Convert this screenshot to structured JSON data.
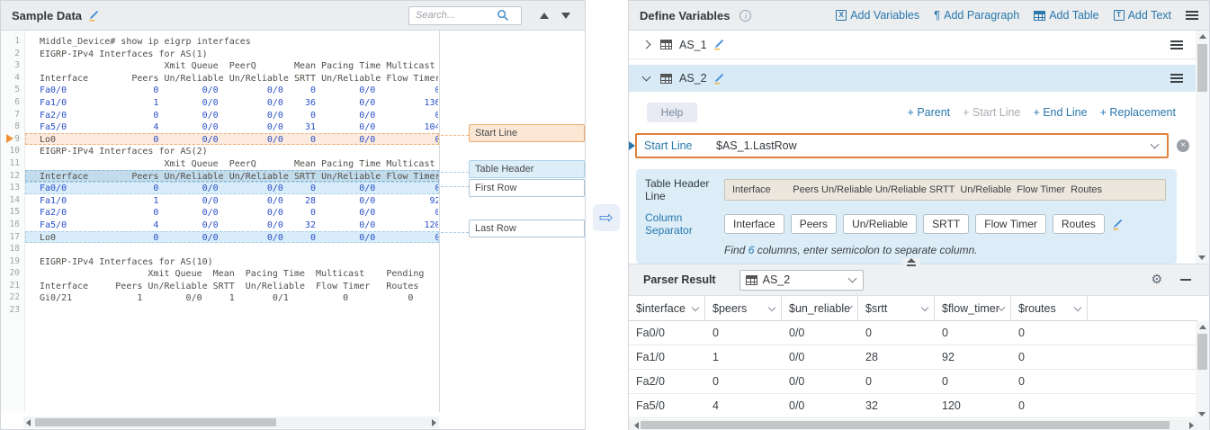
{
  "colors": {
    "accent_blue": "#2878ae",
    "code_blue": "#2b50c9",
    "start_line_orange": "#e0813c",
    "highlight_orange_bg": "#fceade",
    "highlight_blue_bg": "#d8edf9",
    "table_header_bg": "#c2dcec",
    "panel_header_bg": "#ecedef",
    "as2_header_bg": "#d7eaf6",
    "bluebox_bg": "#dcedf8"
  },
  "left_panel": {
    "title": "Sample Data",
    "search_placeholder": "Search...",
    "code_lines": [
      {
        "n": 1,
        "segs": [
          [
            "Middle_Device# show ip eigrp interfaces",
            "k"
          ]
        ]
      },
      {
        "n": 2,
        "segs": [
          [
            "EIGRP-IPv4 Interfaces for AS(1)",
            "k"
          ]
        ]
      },
      {
        "n": 3,
        "segs": [
          [
            "                       Xmit Queue  PeerQ       Mean Pacing Time Multicast",
            "k"
          ]
        ]
      },
      {
        "n": 4,
        "segs": [
          [
            "Interface        Peers Un/Reliable Un/Reliable SRTT Un/Reliable Flow Timer",
            "k"
          ]
        ]
      },
      {
        "n": 5,
        "segs": [
          [
            "Fa0/0                0        0/0         0/0     0        0/0           0",
            "b"
          ]
        ]
      },
      {
        "n": 6,
        "segs": [
          [
            "Fa1/0                1        0/0         0/0    36        0/0         136",
            "b"
          ]
        ]
      },
      {
        "n": 7,
        "segs": [
          [
            "Fa2/0                0        0/0         0/0     0        0/0           0",
            "b"
          ]
        ]
      },
      {
        "n": 8,
        "segs": [
          [
            "Fa5/0                4        0/0         0/0    31        0/0         104",
            "b"
          ]
        ]
      },
      {
        "n": 9,
        "hl": "orange",
        "segs": [
          [
            "Lo0",
            "k"
          ],
          [
            "                  0        0/0         0/0     0        0/0           0",
            "b"
          ]
        ]
      },
      {
        "n": 10,
        "segs": [
          [
            "EIGRP-IPv4 Interfaces for AS(2)",
            "k"
          ]
        ]
      },
      {
        "n": 11,
        "segs": [
          [
            "                       Xmit Queue  PeerQ       Mean Pacing Time Multicast",
            "k"
          ]
        ]
      },
      {
        "n": 12,
        "hl": "steel",
        "segs": [
          [
            "Interface        Peers Un/Reliable Un/Reliable SRTT Un/Reliable Flow Timer",
            "k"
          ]
        ]
      },
      {
        "n": 13,
        "hl": "blue",
        "segs": [
          [
            "Fa0/0                0        0/0         0/0     0        0/0           0",
            "b"
          ]
        ]
      },
      {
        "n": 14,
        "segs": [
          [
            "Fa1/0                1        0/0         0/0    28        0/0          92",
            "b"
          ]
        ]
      },
      {
        "n": 15,
        "segs": [
          [
            "Fa2/0                0        0/0         0/0     0        0/0           0",
            "b"
          ]
        ]
      },
      {
        "n": 16,
        "segs": [
          [
            "Fa5/0                4        0/0         0/0    32        0/0         120",
            "b"
          ]
        ]
      },
      {
        "n": 17,
        "hl": "blue",
        "segs": [
          [
            "Lo0",
            "k"
          ],
          [
            "                  0        0/0         0/0     0        0/0           0",
            "b"
          ]
        ]
      },
      {
        "n": 18,
        "segs": []
      },
      {
        "n": 19,
        "segs": [
          [
            "EIGRP-IPv4 Interfaces for AS(10)",
            "k"
          ]
        ]
      },
      {
        "n": 20,
        "segs": [
          [
            "                    Xmit Queue  Mean  Pacing Time  Multicast    Pending",
            "k"
          ]
        ]
      },
      {
        "n": 21,
        "segs": [
          [
            "Interface     Peers Un/Reliable SRTT  Un/Reliable  Flow Timer   Routes",
            "k"
          ]
        ]
      },
      {
        "n": 22,
        "segs": [
          [
            "Gi0/21            1        0/0     1       0/1          0           0",
            "k"
          ]
        ]
      },
      {
        "n": 23,
        "segs": []
      }
    ]
  },
  "annotations": {
    "start_line": "Start Line",
    "table_header": "Table Header",
    "first_row": "First Row",
    "last_row": "Last Row"
  },
  "right_panel": {
    "title": "Define Variables",
    "toolbar": [
      {
        "name": "add-variables-button",
        "label": "Add Variables",
        "icon": "boxed",
        "glyph": "X",
        "icon_name": "boxed-x-icon"
      },
      {
        "name": "add-paragraph-button",
        "label": "Add Paragraph",
        "icon": "char",
        "glyph": "¶",
        "icon_name": "pilcrow-icon"
      },
      {
        "name": "add-table-button",
        "label": "Add Table",
        "icon": "grid",
        "glyph": "",
        "icon_name": "table-icon"
      },
      {
        "name": "add-text-button",
        "label": "Add Text",
        "icon": "boxed",
        "glyph": "T",
        "icon_name": "boxed-t-icon"
      }
    ],
    "as1": {
      "name": "AS_1"
    },
    "as2": {
      "name": "AS_2",
      "help_label": "Help",
      "links": [
        {
          "label": "+ Parent",
          "muted": false
        },
        {
          "label": "+ Start Line",
          "muted": true
        },
        {
          "label": "+ End Line",
          "muted": false
        },
        {
          "label": "+ Replacement",
          "muted": false
        }
      ],
      "start_line_label": "Start Line",
      "start_line_value": "$AS_1.LastRow",
      "table_header_line_label": "Table Header Line",
      "table_header_line_value": "Interface        Peers Un/Reliable Un/Reliable SRTT  Un/Reliable  Flow Timer  Routes",
      "column_separator_label": "Column Separator",
      "columns": [
        "Interface",
        "Peers",
        "Un/Reliable",
        "SRTT",
        "Flow Timer",
        "Routes"
      ],
      "hint_prefix": "Find ",
      "hint_count": "6",
      "hint_suffix": " columns, enter semicolon to separate column."
    },
    "parser_result": {
      "label": "Parser Result",
      "selected_table": "AS_2",
      "columns": [
        "$interface",
        "$peers",
        "$un_reliable",
        "$srtt",
        "$flow_timer",
        "$routes"
      ],
      "rows": [
        [
          "Fa0/0",
          "0",
          "0/0",
          "0",
          "0",
          "0"
        ],
        [
          "Fa1/0",
          "1",
          "0/0",
          "28",
          "92",
          "0"
        ],
        [
          "Fa2/0",
          "0",
          "0/0",
          "0",
          "0",
          "0"
        ],
        [
          "Fa5/0",
          "4",
          "0/0",
          "32",
          "120",
          "0"
        ]
      ]
    }
  }
}
